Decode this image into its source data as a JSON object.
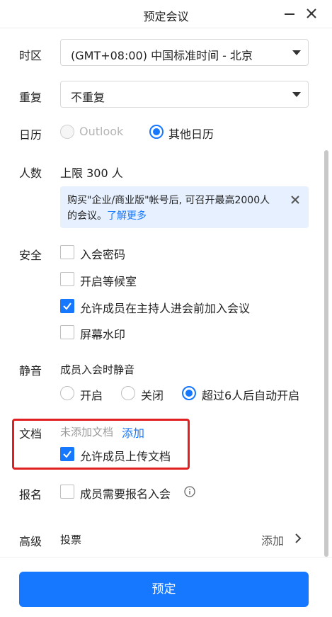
{
  "window": {
    "title": "预定会议"
  },
  "timezone": {
    "label": "时区",
    "value": "(GMT+08:00) 中国标准时间 - 北京"
  },
  "repeat": {
    "label": "重复",
    "value": "不重复"
  },
  "calendar": {
    "label": "日历",
    "options": [
      "Outlook",
      "其他日历"
    ],
    "selected": "其他日历"
  },
  "participants": {
    "label": "人数",
    "limit_text": "上限 300 人",
    "notice_line1": "购买\"企业/商业版\"帐号后, 可召开最高2000人",
    "notice_line2": "的会议。",
    "notice_link": "了解更多"
  },
  "security": {
    "label": "安全",
    "options": [
      {
        "label": "入会密码",
        "checked": false
      },
      {
        "label": "开启等候室",
        "checked": false
      },
      {
        "label": "允许成员在主持人进会前加入会议",
        "checked": true
      },
      {
        "label": "屏幕水印",
        "checked": false
      }
    ]
  },
  "mute": {
    "label": "静音",
    "subtitle": "成员入会时静音",
    "options": [
      "开启",
      "关闭",
      "超过6人后自动开启"
    ],
    "selected": "超过6人后自动开启"
  },
  "documents": {
    "label": "文档",
    "status": "未添加文档",
    "add_link": "添加",
    "allow_upload_label": "允许成员上传文档",
    "allow_upload_checked": true
  },
  "registration": {
    "label": "报名",
    "option_label": "成员需要报名入会",
    "checked": false
  },
  "advanced": {
    "label": "高级",
    "item": "投票",
    "action": "添加"
  },
  "footer": {
    "submit_label": "预定"
  },
  "colors": {
    "accent": "#1677ff",
    "highlight": "#e02020"
  }
}
